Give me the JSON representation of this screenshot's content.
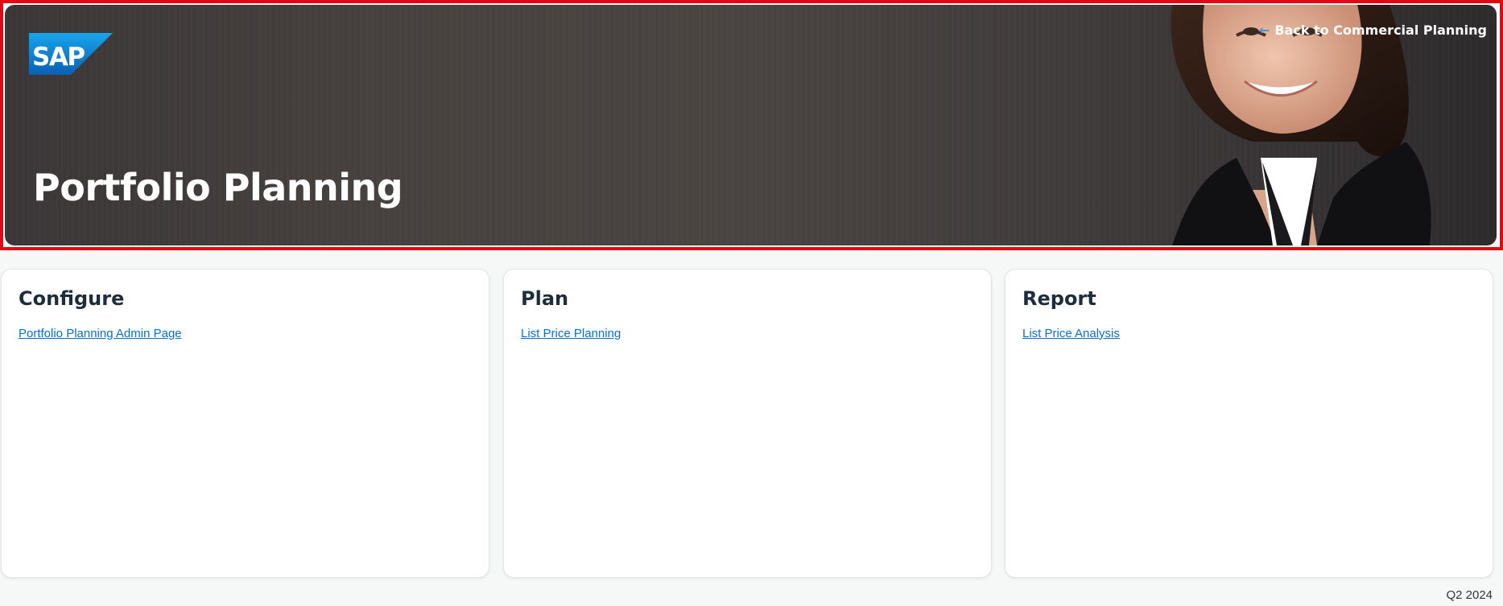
{
  "header": {
    "title": "Portfolio Planning",
    "back_link": "Back to Commercial Planning",
    "logo_text": "SAP"
  },
  "cards": [
    {
      "title": "Configure",
      "link": "Portfolio Planning Admin Page"
    },
    {
      "title": "Plan",
      "link": "List Price Planning"
    },
    {
      "title": "Report",
      "link": "List Price Analysis"
    }
  ],
  "footer": {
    "version": "Q2 2024"
  },
  "colors": {
    "highlight_border": "#e30613",
    "link": "#0a6ed1",
    "logo_blue": "#0b79cf",
    "title_text": "#1d2d3e"
  }
}
